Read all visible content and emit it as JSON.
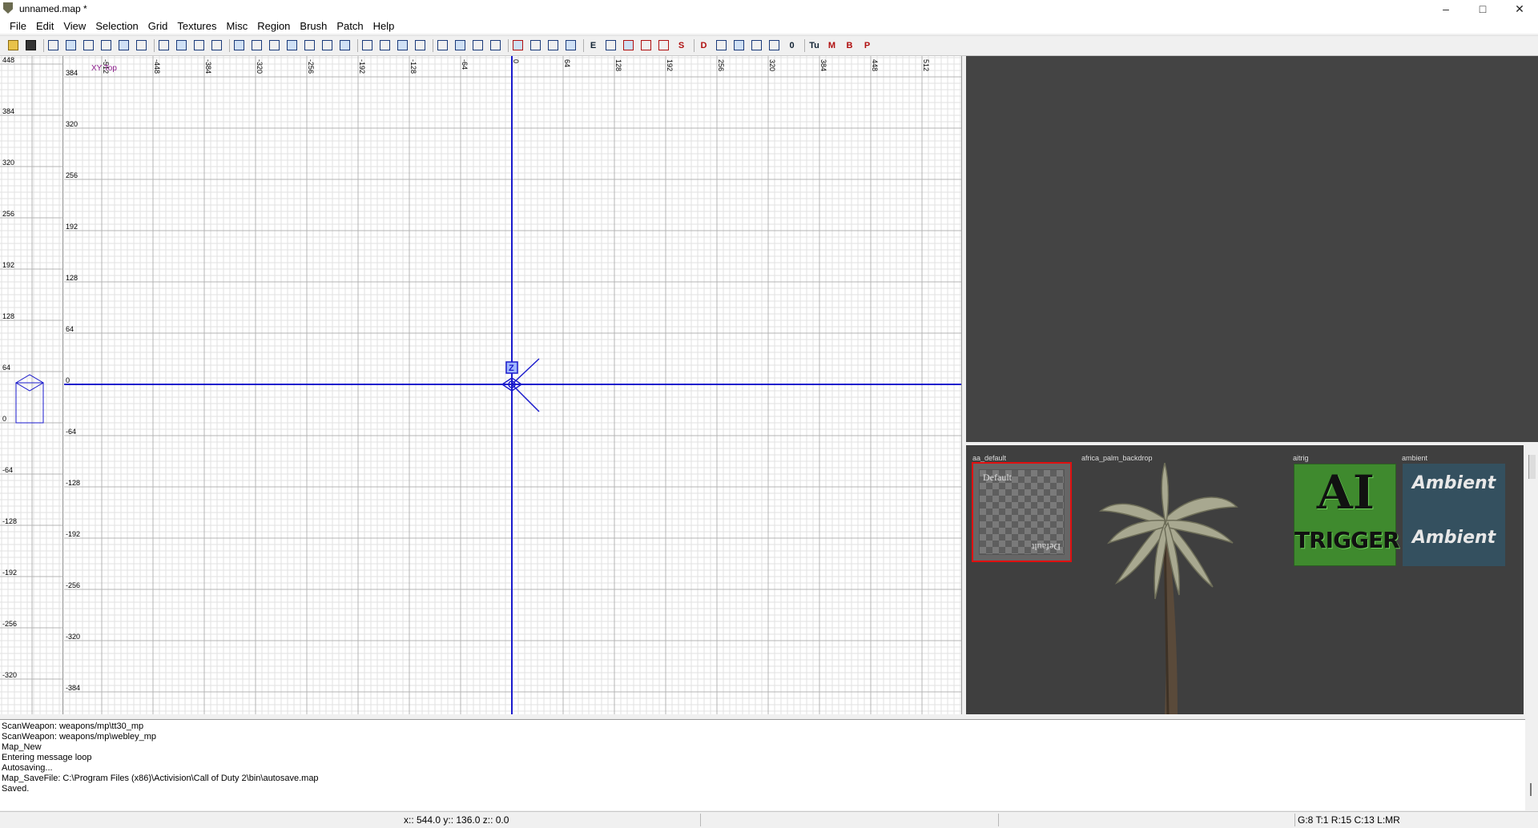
{
  "window": {
    "title": "unnamed.map *",
    "minimize": "–",
    "maximize": "□",
    "close": "✕"
  },
  "menu": [
    "File",
    "Edit",
    "View",
    "Selection",
    "Grid",
    "Textures",
    "Misc",
    "Region",
    "Brush",
    "Patch",
    "Help"
  ],
  "toolbar_icons": [
    "open-icon",
    "save-icon",
    "flip-x-icon",
    "flip-y-icon",
    "flip-z-icon",
    "rotate-x-icon",
    "rotate-y-icon",
    "rotate-z-icon",
    "select-complete-tall-icon",
    "select-touching-icon",
    "select-partial-tall-icon",
    "select-inside-icon",
    "csg-subtract-icon",
    "csg-merge-icon",
    "hollow-icon",
    "texture-fit-icon",
    "texture-flip-icon",
    "texture-cycle-icon",
    "cycle-layer-icon",
    "change-views-icon",
    "texture-view-icon",
    "xy-view-icon",
    "camera-icon",
    "scale-icon",
    "x-view-icon",
    "y-view-icon",
    "z-view-icon",
    "clipper-icon",
    "patch-icon",
    "bend-icon",
    "curve-icon",
    "entity-icon",
    "brush-icon",
    "model-icon",
    "fx-icon",
    "light-icon",
    "sound-icon",
    "decal-icon",
    "node-icon",
    "drop-icon",
    "spline-icon",
    "grid-icon",
    "zero-icon",
    "texture-lock-icon",
    "m-icon",
    "b-icon",
    "p-icon"
  ],
  "toolbar_labels": {
    "bold_m": "M",
    "bold_b": "B",
    "bold_p": "P",
    "tu": "Tu",
    "zero": "0",
    "d": "D",
    "s": "S",
    "e": "E"
  },
  "xy_view": {
    "label": "XY Top",
    "top_ticks": [
      "-512",
      "-448",
      "-384",
      "-320",
      "-256",
      "-192",
      "-128",
      "-64",
      "0",
      "64",
      "128",
      "192",
      "256",
      "320",
      "384",
      "448",
      "512"
    ],
    "left_ticks": [
      "384",
      "320",
      "256",
      "192",
      "128",
      "64",
      "0",
      "-64",
      "-128",
      "-192",
      "-256",
      "-320",
      "-384"
    ],
    "camera_marker": "Z"
  },
  "z_view": {
    "ticks": [
      "448",
      "384",
      "320",
      "256",
      "192",
      "128",
      "64",
      "0",
      "-64",
      "-128",
      "-192",
      "-256",
      "-320"
    ]
  },
  "texture_browser": {
    "items": [
      {
        "name": "aa_default",
        "caption_top": "Default",
        "caption_bottom": "Default"
      },
      {
        "name": "africa_palm_backdrop"
      },
      {
        "name": "aitrig",
        "line1": "AI",
        "line2": "TRIGGER"
      },
      {
        "name": "ambient",
        "line1": "Ambient",
        "line2": "Ambient"
      }
    ]
  },
  "console": {
    "lines": [
      "ScanWeapon: weapons/mp\\tt30_mp",
      "ScanWeapon: weapons/mp\\webley_mp",
      "Map_New",
      "Entering message loop",
      "Autosaving...",
      "Map_SaveFile: C:\\Program Files (x86)\\Activision\\Call of Duty 2\\bin\\autosave.map",
      "Saved."
    ]
  },
  "status": {
    "coords": "x:: 544.0  y:: 136.0  z:: 0.0",
    "grid": "G:8 T:1 R:15 C:13 L:MR"
  },
  "colors": {
    "axis": "#1a1acc",
    "grid_minor": "#e2e2e2",
    "grid_major": "#b4b4b4",
    "selected_border": "#e01010",
    "aitrig_bg": "#3f8a2e",
    "ambient_bg": "#34505f"
  }
}
